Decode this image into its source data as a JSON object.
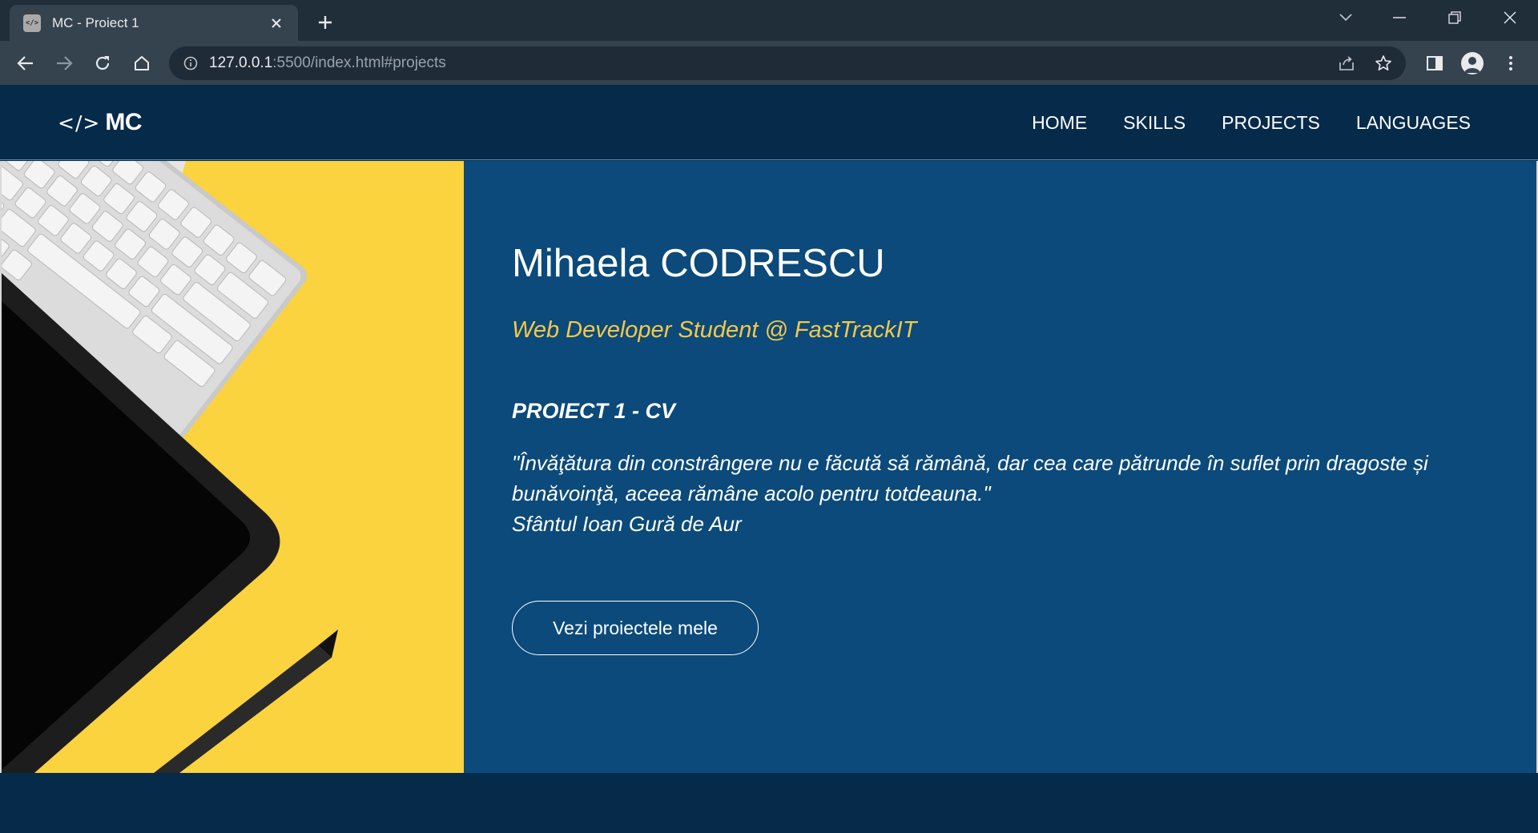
{
  "browser": {
    "tab_title": "MC - Proiect 1",
    "favicon_text": "</>",
    "url_host": "127.0.0.1",
    "url_rest": ":5500/index.html#projects"
  },
  "site": {
    "logo_code": "</>",
    "logo_text": "MC",
    "nav": [
      {
        "label": "HOME"
      },
      {
        "label": "SKILLS"
      },
      {
        "label": "PROJECTS"
      },
      {
        "label": "LANGUAGES"
      }
    ]
  },
  "hero": {
    "name": "Mihaela CODRESCU",
    "role": "Web Developer Student @ FastTrackIT",
    "project_title": "PROIECT 1 - CV",
    "quote_line1": "\"Învăţătura din constrângere nu e făcută să rămână, dar cea care pătrunde în suflet prin dragoste și bunăvoinţă, aceea rămâne acolo pentru totdeauna.\"",
    "quote_author": "Sfântul Ioan Gură de Aur",
    "cta_label": "Vezi proiectele mele"
  },
  "colors": {
    "header_bg": "#062a4a",
    "hero_bg": "#0b4a7a",
    "accent": "#f6c84a",
    "image_yellow": "#fbd33e"
  }
}
